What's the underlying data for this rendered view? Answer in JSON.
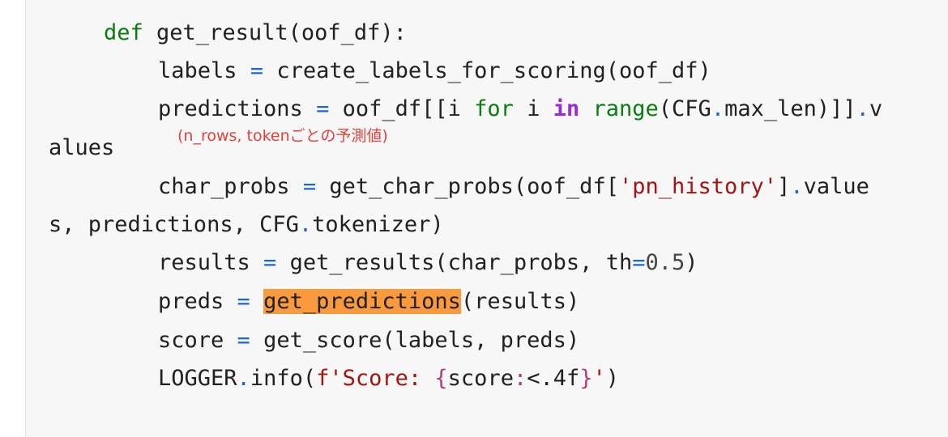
{
  "code": {
    "line1": {
      "kw": "def",
      "rest": " get_result(oof_df):"
    },
    "line2": {
      "a": "labels ",
      "eq": "=",
      "b": " create_labels_for_scoring(oof_df)"
    },
    "line3": {
      "a": "predictions ",
      "eq": "=",
      "b": " oof_df[[i ",
      "for": "for",
      "c": " i ",
      "in": "in",
      "range": " range",
      "d": "(CFG",
      "dot": ".",
      "e": "max_len)]]",
      "dot2": ".",
      "f": "v"
    },
    "line4": {
      "text": "alues"
    },
    "line5": {
      "a": "char_probs ",
      "eq": "=",
      "b": " get_char_probs(oof_df[",
      "str": "'pn_history'",
      "c": "]",
      "dot": ".",
      "d": "value"
    },
    "line6": {
      "a": "s, predictions, CFG",
      "dot": ".",
      "b": "tokenizer)"
    },
    "line7": {
      "a": "results ",
      "eq": "=",
      "b": " get_results(char_probs, th",
      "eq2": "=",
      "num": "0.5",
      "c": ")"
    },
    "line8": {
      "a": "preds ",
      "eq": "=",
      "sp": " ",
      "hl": "get_predictions",
      "b": "(results)"
    },
    "line9": {
      "a": "score ",
      "eq": "=",
      "b": " get_score(labels, preds)"
    },
    "line10": {
      "a": "LOGGER",
      "dot": ".",
      "b": "info(",
      "str1": "f'Score: ",
      "br1": "{",
      "c": "score",
      "colon": ":",
      "d": "<.4f",
      "br2": "}",
      "str2": "'",
      "e": ")"
    }
  },
  "annotation": "(n_rows, tokenごとの予測値)",
  "colors": {
    "keyword": "#0a7d12",
    "in_keyword": "#9b2bd8",
    "operator": "#1a67d2",
    "string": "#a31515",
    "highlight": "#fa9a3e",
    "annotation": "#e0433e"
  }
}
